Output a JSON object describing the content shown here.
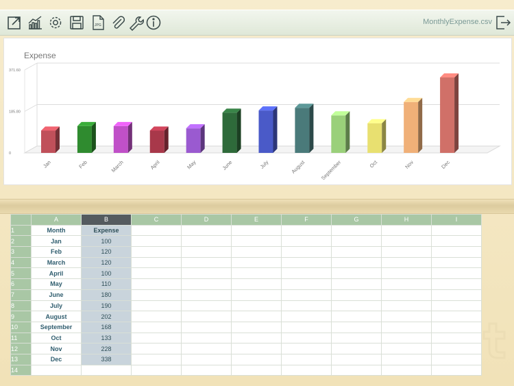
{
  "toolbar": {
    "icons": [
      "expand-icon",
      "chart-icon",
      "settings-icon",
      "save-icon",
      "jpg-export-icon",
      "attach-icon",
      "wrench-icon",
      "info-icon"
    ],
    "filename": "MonthlyExpense.csv",
    "exit_icon": "exit-icon"
  },
  "chart_data": {
    "type": "bar",
    "title": "Expense",
    "categories": [
      "Jan",
      "Feb",
      "March",
      "April",
      "May",
      "June",
      "July",
      "August",
      "September",
      "Oct",
      "Nov",
      "Dec"
    ],
    "values": [
      100,
      120,
      120,
      100,
      110,
      180,
      190,
      202,
      168,
      133,
      228,
      338
    ],
    "yticks": [
      "0",
      "185.80",
      "371.60"
    ],
    "ylim": [
      0,
      371.6
    ],
    "colors": [
      "#c0505a",
      "#2f8b2f",
      "#c050c8",
      "#a8384a",
      "#9a5ad0",
      "#2e6a3a",
      "#4a5ac8",
      "#4a7a7a",
      "#9ad07a",
      "#e8e070",
      "#f0b078",
      "#d07068"
    ],
    "grid": true
  },
  "sheet": {
    "columns": [
      "A",
      "B",
      "C",
      "D",
      "E",
      "F",
      "G",
      "H",
      "I"
    ],
    "selected_column": "B",
    "rows": [
      [
        "1",
        "Month",
        "Expense"
      ],
      [
        "2",
        "Jan",
        "100"
      ],
      [
        "3",
        "Feb",
        "120"
      ],
      [
        "4",
        "March",
        "120"
      ],
      [
        "5",
        "April",
        "100"
      ],
      [
        "6",
        "May",
        "110"
      ],
      [
        "7",
        "June",
        "180"
      ],
      [
        "8",
        "July",
        "190"
      ],
      [
        "9",
        "August",
        "202"
      ],
      [
        "10",
        "September",
        "168"
      ],
      [
        "11",
        "Oct",
        "133"
      ],
      [
        "12",
        "Nov",
        "228"
      ],
      [
        "13",
        "Dec",
        "338"
      ],
      [
        "14",
        "",
        ""
      ]
    ]
  }
}
